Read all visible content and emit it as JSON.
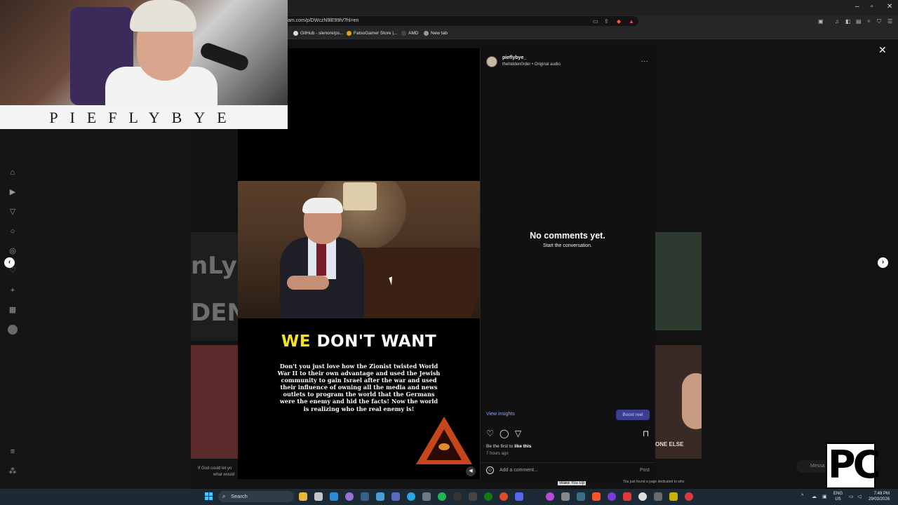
{
  "browser": {
    "url": "am.com/p/DWczN9lE99h/?hl=en",
    "bookmarks": [
      {
        "label": "GitHub - slenore/ps..."
      },
      {
        "label": "FatsoGamer Store |..."
      },
      {
        "label": "AMD"
      },
      {
        "label": "New tab"
      }
    ]
  },
  "webcam": {
    "name_plate": "PIEFLYBYE"
  },
  "reel": {
    "headline_yellow": "WE",
    "headline_white": "DON'T WANT",
    "caption": "Don't you just love how the Zionist twisted World War II to their own advantage and used the Jewish community to gain Israel after the war and used their influence of owning all the media and news outlets to program the world that the Germans were the enemy and hid the facts! Now the world is realizing who the real enemy is!"
  },
  "post": {
    "username": "pieflybye_",
    "audio": "thehidden0rder • Original audio",
    "more": "...",
    "no_comments": "No comments yet.",
    "start_conversation": "Start the conversation.",
    "view_insights": "View insights",
    "boost_reel": "Boost reel",
    "first_like_prefix": "Be the first to ",
    "first_like_bold": "like this",
    "time_ago": "7 hours ago",
    "add_comment_placeholder": "Add a comment...",
    "post_button": "Post"
  },
  "feed": {
    "right_text_1": "Wake You Up",
    "right_text_2": "You just found a page dedicated to who",
    "right_text_3": "ONE ELSE",
    "left_text_1": "If God could let yo",
    "left_text_2": "what would",
    "messages_label": "Messa"
  },
  "logo": {
    "text": "PC"
  },
  "taskbar": {
    "search_label": "Search",
    "lang_top": "ENG",
    "lang_bottom": "US",
    "time": "7:49 PM",
    "date": "29/03/2026"
  },
  "colors": {
    "headline_yellow": "#f4e21c",
    "insights_link": "#93a6ff",
    "boost_button": "#3b3e8f"
  }
}
